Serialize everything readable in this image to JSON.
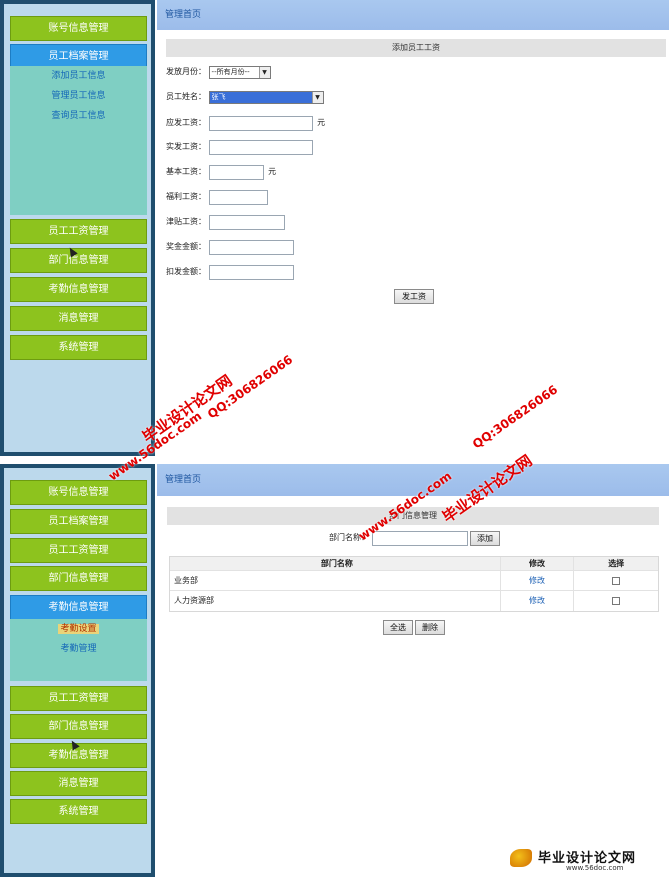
{
  "panel1": {
    "sidebar": {
      "items": [
        {
          "label": "账号信息管理"
        },
        {
          "label": "员工档案管理"
        },
        {
          "label": "员工工资管理"
        },
        {
          "label": "部门信息管理"
        },
        {
          "label": "考勤信息管理"
        },
        {
          "label": "消息管理"
        },
        {
          "label": "系统管理"
        }
      ],
      "sub_items": [
        {
          "label": "添加员工信息"
        },
        {
          "label": "管理员工信息"
        },
        {
          "label": "查询员工信息"
        }
      ]
    },
    "header": {
      "title": "管理首页"
    },
    "form": {
      "title": "添加员工工资",
      "month_label": "发放月份：",
      "month_value": "--所有月份--",
      "name_label": "员工姓名：",
      "name_value": "张飞",
      "should_pay_label": "应发工资：",
      "actual_pay_label": "实发工资：",
      "base_pay_label": "基本工资：",
      "welfare_label": "福利工资：",
      "allowance_label": "津贴工资：",
      "bonus_label": "奖金金额：",
      "deduct_label": "扣发金额：",
      "unit_yuan": "元",
      "submit_label": "发工资"
    }
  },
  "panel2": {
    "sidebar": {
      "items": [
        {
          "label": "账号信息管理"
        },
        {
          "label": "员工档案管理"
        },
        {
          "label": "员工工资管理"
        },
        {
          "label": "部门信息管理"
        },
        {
          "label": "考勤信息管理"
        },
        {
          "label": "员工工资管理"
        },
        {
          "label": "部门信息管理"
        },
        {
          "label": "考勤信息管理"
        },
        {
          "label": "消息管理"
        },
        {
          "label": "系统管理"
        }
      ],
      "sub_items": [
        {
          "label": "考勤设置"
        },
        {
          "label": "考勤管理"
        }
      ]
    },
    "header": {
      "title": "管理首页"
    },
    "dept": {
      "title": "部门信息管理",
      "name_label": "部门名称：",
      "add_label": "添加",
      "columns": {
        "name": "部门名称",
        "edit": "修改",
        "select": "选择"
      },
      "rows": [
        {
          "name": "业务部",
          "edit": "修改"
        },
        {
          "name": "人力资源部",
          "edit": "修改"
        }
      ],
      "select_all_label": "全选",
      "delete_label": "删除"
    }
  },
  "watermarks": {
    "site_name": "毕业设计论文网",
    "url": "www.56doc.com",
    "qq": "QQ:306826066"
  },
  "logo": {
    "title": "毕业设计论文网",
    "url": "www.56doc.com"
  },
  "colors": {
    "menu_green": "#8dc31e",
    "menu_active_blue": "#2f9be6",
    "header_blue": "#a9c8ef",
    "watermark_red": "#e00000"
  }
}
